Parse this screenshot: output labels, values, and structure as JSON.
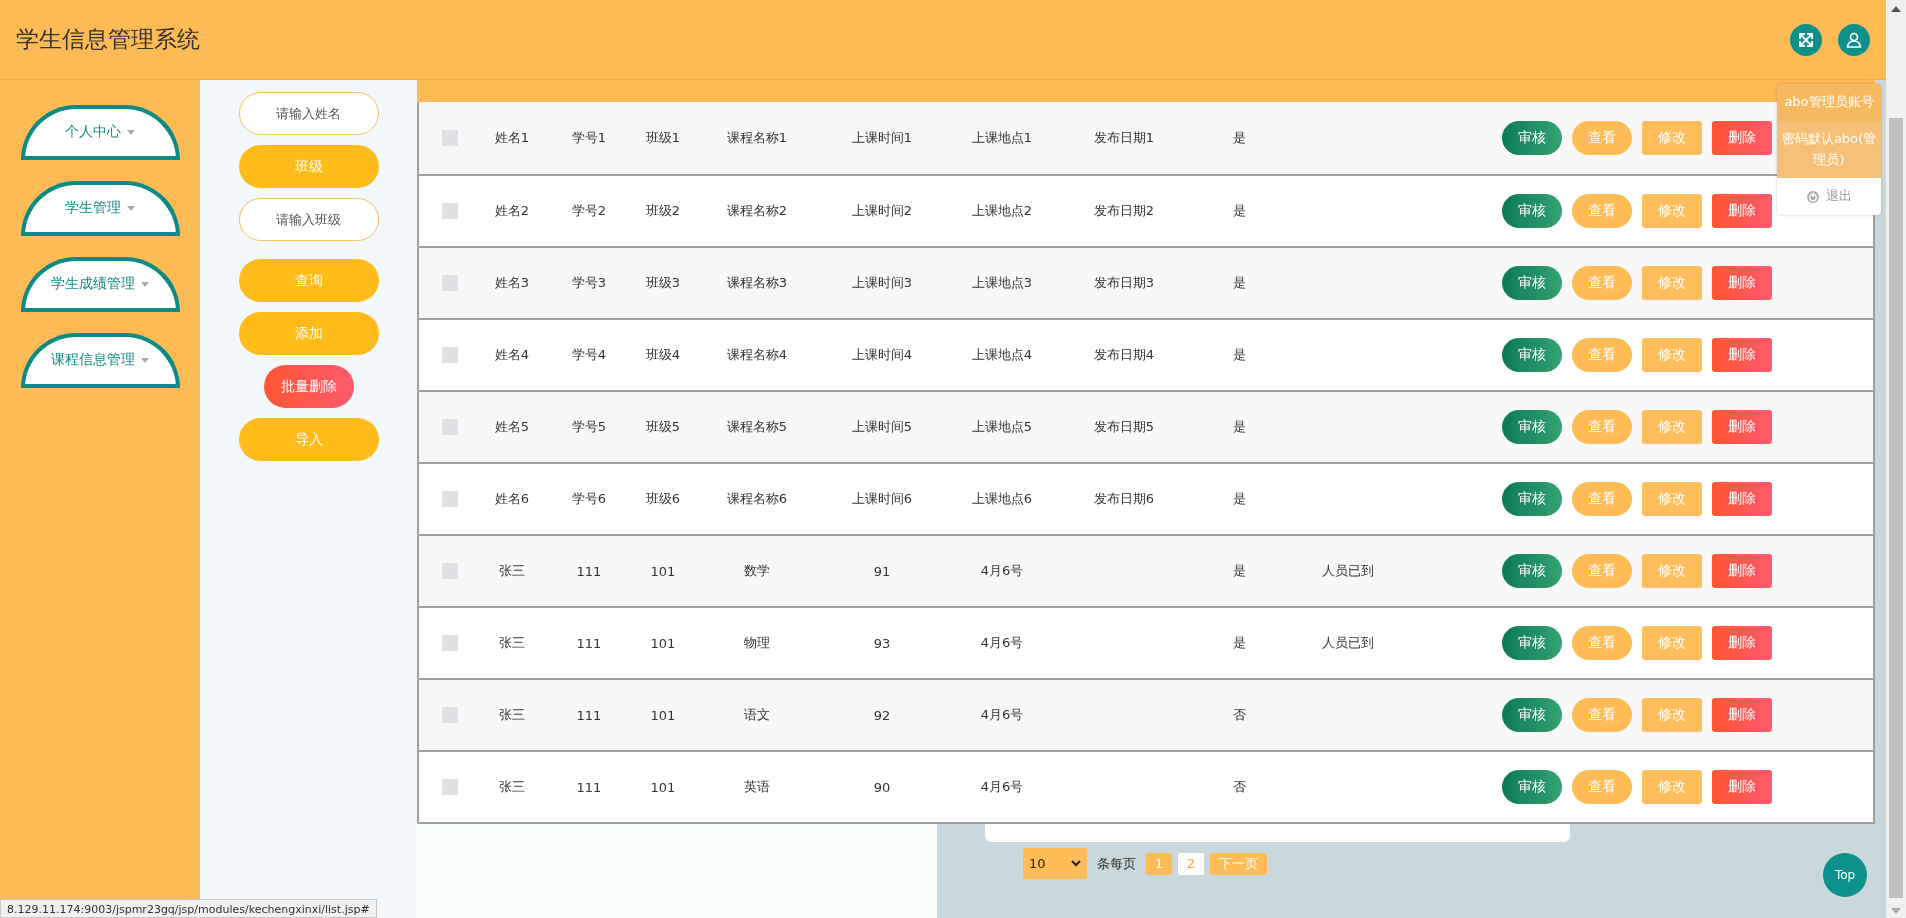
{
  "header": {
    "title": "学生信息管理系统"
  },
  "user_menu": {
    "items": [
      {
        "kind": "account",
        "label": "abo管理员账号"
      },
      {
        "kind": "password",
        "label": "密码默认abo(管理员)"
      },
      {
        "kind": "logout",
        "label": "退出"
      }
    ]
  },
  "sidebar": {
    "items": [
      {
        "label": "个人中心"
      },
      {
        "label": "学生管理"
      },
      {
        "label": "学生成绩管理"
      },
      {
        "label": "课程信息管理"
      }
    ]
  },
  "filters": [
    {
      "kind": "input",
      "placeholder": "请输入姓名"
    },
    {
      "kind": "button",
      "label": "班级"
    },
    {
      "kind": "input",
      "placeholder": "请输入班级"
    },
    {
      "kind": "button",
      "label": "查询"
    },
    {
      "kind": "button",
      "label": "添加"
    },
    {
      "kind": "danger",
      "label": "批量删除"
    },
    {
      "kind": "button",
      "label": "导入"
    }
  ],
  "table": {
    "rows": [
      {
        "checked": false,
        "column_1": "姓名1",
        "column_2": "学号1",
        "column_3": "班级1",
        "column_4": "课程名称1",
        "column_5": "上课时间1",
        "column_6": "上课地点1",
        "column_7": "发布日期1",
        "column_8": "是",
        "actions": [
          {
            "kind": "review",
            "label": "审核"
          },
          {
            "kind": "view",
            "label": "查看"
          },
          {
            "kind": "edit",
            "label": "修改"
          },
          {
            "kind": "delete",
            "label": "删除"
          }
        ]
      },
      {
        "checked": false,
        "column_1": "姓名2",
        "column_2": "学号2",
        "column_3": "班级2",
        "column_4": "课程名称2",
        "column_5": "上课时间2",
        "column_6": "上课地点2",
        "column_7": "发布日期2",
        "column_8": "是",
        "actions": [
          {
            "kind": "review",
            "label": "审核"
          },
          {
            "kind": "view",
            "label": "查看"
          },
          {
            "kind": "edit",
            "label": "修改"
          },
          {
            "kind": "delete",
            "label": "删除"
          }
        ]
      },
      {
        "checked": false,
        "column_1": "姓名3",
        "column_2": "学号3",
        "column_3": "班级3",
        "column_4": "课程名称3",
        "column_5": "上课时间3",
        "column_6": "上课地点3",
        "column_7": "发布日期3",
        "column_8": "是",
        "actions": [
          {
            "kind": "review",
            "label": "审核"
          },
          {
            "kind": "view",
            "label": "查看"
          },
          {
            "kind": "edit",
            "label": "修改"
          },
          {
            "kind": "delete",
            "label": "删除"
          }
        ]
      },
      {
        "checked": false,
        "column_1": "姓名4",
        "column_2": "学号4",
        "column_3": "班级4",
        "column_4": "课程名称4",
        "column_5": "上课时间4",
        "column_6": "上课地点4",
        "column_7": "发布日期4",
        "column_8": "是",
        "actions": [
          {
            "kind": "review",
            "label": "审核"
          },
          {
            "kind": "view",
            "label": "查看"
          },
          {
            "kind": "edit",
            "label": "修改"
          },
          {
            "kind": "delete",
            "label": "删除"
          }
        ]
      },
      {
        "checked": false,
        "column_1": "姓名5",
        "column_2": "学号5",
        "column_3": "班级5",
        "column_4": "课程名称5",
        "column_5": "上课时间5",
        "column_6": "上课地点5",
        "column_7": "发布日期5",
        "column_8": "是",
        "actions": [
          {
            "kind": "review",
            "label": "审核"
          },
          {
            "kind": "view",
            "label": "查看"
          },
          {
            "kind": "edit",
            "label": "修改"
          },
          {
            "kind": "delete",
            "label": "删除"
          }
        ]
      },
      {
        "checked": false,
        "column_1": "姓名6",
        "column_2": "学号6",
        "column_3": "班级6",
        "column_4": "课程名称6",
        "column_5": "上课时间6",
        "column_6": "上课地点6",
        "column_7": "发布日期6",
        "column_8": "是",
        "actions": [
          {
            "kind": "review",
            "label": "审核"
          },
          {
            "kind": "view",
            "label": "查看"
          },
          {
            "kind": "edit",
            "label": "修改"
          },
          {
            "kind": "delete",
            "label": "删除"
          }
        ]
      },
      {
        "checked": false,
        "column_1": "张三",
        "column_2": "111",
        "column_3": "101",
        "column_4": "数学",
        "column_5": "91",
        "column_6": "4月6号",
        "column_8": "是",
        "column_9": "人员已到",
        "actions": [
          {
            "kind": "review",
            "label": "审核"
          },
          {
            "kind": "view",
            "label": "查看"
          },
          {
            "kind": "edit",
            "label": "修改"
          },
          {
            "kind": "delete",
            "label": "删除"
          }
        ]
      },
      {
        "checked": false,
        "column_1": "张三",
        "column_2": "111",
        "column_3": "101",
        "column_4": "物理",
        "column_5": "93",
        "column_6": "4月6号",
        "column_8": "是",
        "column_9": "人员已到",
        "actions": [
          {
            "kind": "review",
            "label": "审核"
          },
          {
            "kind": "view",
            "label": "查看"
          },
          {
            "kind": "edit",
            "label": "修改"
          },
          {
            "kind": "delete",
            "label": "删除"
          }
        ]
      },
      {
        "checked": false,
        "column_1": "张三",
        "column_2": "111",
        "column_3": "101",
        "column_4": "语文",
        "column_5": "92",
        "column_6": "4月6号",
        "column_8": "否",
        "actions": [
          {
            "kind": "review",
            "label": "审核"
          },
          {
            "kind": "view",
            "label": "查看"
          },
          {
            "kind": "edit",
            "label": "修改"
          },
          {
            "kind": "delete",
            "label": "删除"
          }
        ]
      },
      {
        "checked": false,
        "column_1": "张三",
        "column_2": "111",
        "column_3": "101",
        "column_4": "英语",
        "column_5": "90",
        "column_6": "4月6号",
        "column_8": "否",
        "actions": [
          {
            "kind": "review",
            "label": "审核"
          },
          {
            "kind": "view",
            "label": "查看"
          },
          {
            "kind": "edit",
            "label": "修改"
          },
          {
            "kind": "delete",
            "label": "删除"
          }
        ]
      }
    ]
  },
  "pagination": {
    "page_size": "10",
    "per_page_label": "条每页",
    "pages": [
      {
        "label": "1",
        "selected": true
      },
      {
        "label": "2",
        "selected": false
      }
    ],
    "next": "下一页"
  },
  "top_button": "Top",
  "status_bar": {
    "url": "8.129.11.174:9003/jspmr23gq/jsp/modules/kechengxinxi/list.jsp#"
  }
}
